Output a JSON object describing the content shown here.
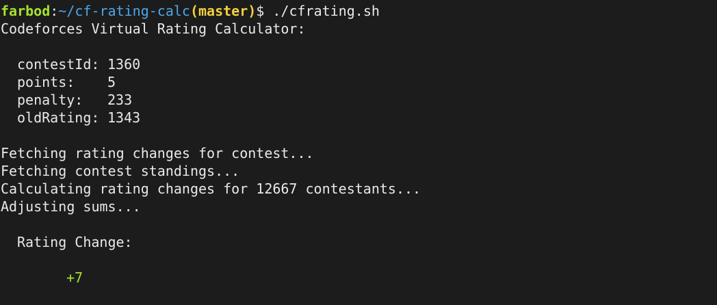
{
  "prompt": {
    "user": "farbod",
    "separator": ":",
    "path": "~/cf-rating-calc",
    "branch": "(master)",
    "symbol": "$",
    "command": "./cfrating.sh"
  },
  "colors": {
    "background": "#1c1c1c",
    "text": "#e9e9e9",
    "user": "#a6e22e",
    "path": "#4ea6ea",
    "branch": "#f4d03f",
    "result": "#a6e22e"
  },
  "output": {
    "title": "Codeforces Virtual Rating Calculator:",
    "params": [
      {
        "key": "contestId:",
        "value": "1360"
      },
      {
        "key": "points:",
        "value": "5"
      },
      {
        "key": "penalty:",
        "value": "233"
      },
      {
        "key": "oldRating:",
        "value": "1343"
      }
    ],
    "steps": [
      "Fetching rating changes for contest...",
      "Fetching contest standings...",
      "Calculating rating changes for 12667 contestants...",
      "Adjusting sums..."
    ],
    "result_label": "Rating Change:",
    "result_value": "+7"
  }
}
